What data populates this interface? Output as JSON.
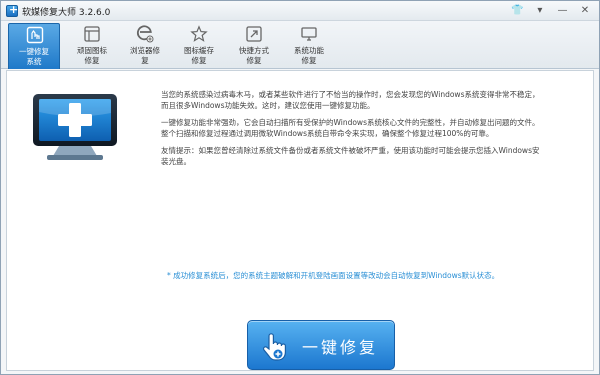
{
  "window": {
    "title": "软媒修复大师 3.2.6.0"
  },
  "window_controls": [
    {
      "name": "skin",
      "glyph": "👕"
    },
    {
      "name": "menu",
      "glyph": "▾"
    },
    {
      "name": "minimize",
      "glyph": "—"
    },
    {
      "name": "close",
      "glyph": "✕"
    }
  ],
  "toolbar": {
    "tools": [
      {
        "id": "one-key",
        "label": "一键修复\n系统",
        "icon": "one-key-repair-icon",
        "active": true
      },
      {
        "id": "stubborn-icon",
        "label": "顽固图标\n修复",
        "icon": "stubborn-icon-repair-icon",
        "active": false
      },
      {
        "id": "browser",
        "label": "浏览器修\n复",
        "icon": "browser-repair-icon",
        "active": false
      },
      {
        "id": "icon-cache",
        "label": "图标缓存\n修复",
        "icon": "icon-cache-repair-icon",
        "active": false
      },
      {
        "id": "shortcut",
        "label": "快捷方式\n修复",
        "icon": "shortcut-repair-icon",
        "active": false
      },
      {
        "id": "system-function",
        "label": "系统功能\n修复",
        "icon": "system-function-repair-icon",
        "active": false
      }
    ]
  },
  "main": {
    "paragraphs": [
      "当您的系统感染过病毒木马，或者某些软件进行了不恰当的操作时，您会发现您的Windows系统变得非常不稳定，而且很多Windows功能失效。这时，建议您使用一键修复功能。",
      "一键修复功能非常强劲，它会自动扫描所有受保护的Windows系统核心文件的完整性，并自动修复出问题的文件。整个扫描和修复过程通过调用微软Windows系统自带命令来实现，确保整个修复过程100%的可靠。",
      "友情提示：如果您曾经清除过系统文件备份或者系统文件被破坏严重，使用该功能时可能会提示您插入Windows安装光盘。"
    ],
    "note": "* 成功修复系统后，您的系统主题破解和开机登陆画面设置等改动会自动恢复到Windows默认状态。",
    "button_label": "一键修复"
  }
}
